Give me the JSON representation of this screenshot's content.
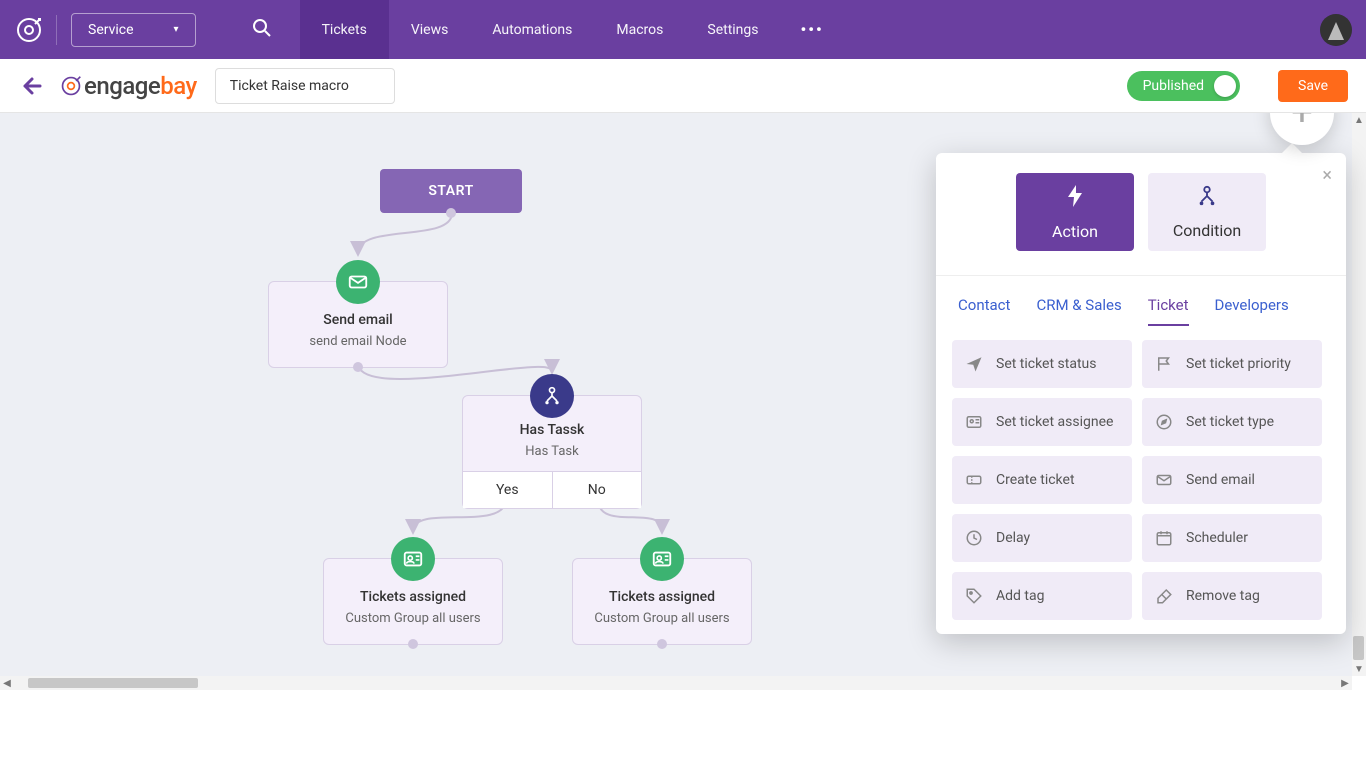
{
  "topbar": {
    "service_label": "Service",
    "nav": [
      "Tickets",
      "Views",
      "Automations",
      "Macros",
      "Settings"
    ],
    "active_nav_index": 0
  },
  "subheader": {
    "brand_engage": "engage",
    "brand_bay": "bay",
    "macro_name": "Ticket Raise macro",
    "published_label": "Published",
    "save_label": "Save"
  },
  "flow": {
    "start_label": "START",
    "nodes": {
      "send_email": {
        "title": "Send email",
        "subtitle": "send email Node"
      },
      "has_task": {
        "title": "Has Tassk",
        "subtitle": "Has Task",
        "yes": "Yes",
        "no": "No"
      },
      "assigned_yes": {
        "title": "Tickets assigned",
        "subtitle": "Custom Group all users"
      },
      "assigned_no": {
        "title": "Tickets assigned",
        "subtitle": "Custom Group all users"
      }
    }
  },
  "popover": {
    "action_label": "Action",
    "condition_label": "Condition",
    "sub_tabs": [
      "Contact",
      "CRM & Sales",
      "Ticket",
      "Developers"
    ],
    "active_sub_tab_index": 2,
    "actions": [
      {
        "icon": "plane",
        "label": "Set ticket status"
      },
      {
        "icon": "flag",
        "label": "Set ticket priority"
      },
      {
        "icon": "id",
        "label": "Set ticket assignee"
      },
      {
        "icon": "compass",
        "label": "Set ticket type"
      },
      {
        "icon": "ticket",
        "label": "Create ticket"
      },
      {
        "icon": "mail",
        "label": "Send email"
      },
      {
        "icon": "clock",
        "label": "Delay"
      },
      {
        "icon": "calendar",
        "label": "Scheduler"
      },
      {
        "icon": "tag",
        "label": "Add tag"
      },
      {
        "icon": "eraser",
        "label": "Remove tag"
      }
    ]
  }
}
